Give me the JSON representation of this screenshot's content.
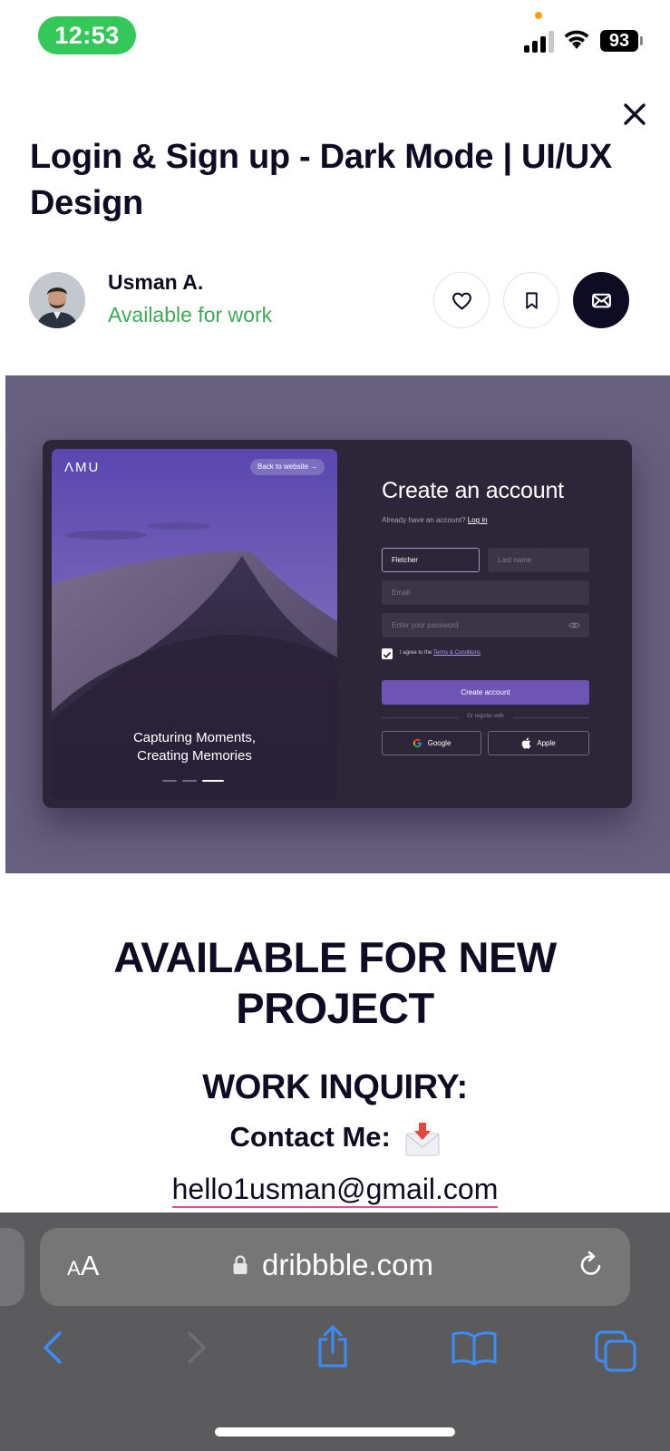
{
  "status_bar": {
    "time": "12:53",
    "battery": "93"
  },
  "shot": {
    "title": "Login & Sign up - Dark Mode | UI/UX Design",
    "author": {
      "name": "Usman A.",
      "status": "Available for work"
    },
    "actions": [
      "like",
      "save",
      "message"
    ],
    "preview": {
      "logo": "ΛMU",
      "back_link": "Back to website",
      "caption_line1": "Capturing Moments,",
      "caption_line2": "Creating Memories",
      "form_title": "Create an account",
      "have_account": "Already have an account?",
      "login_link": "Log in",
      "first_name_value": "Fletcher",
      "last_name_placeholder": "Last name",
      "email_placeholder": "Email",
      "password_placeholder": "Enter your password",
      "agree_prefix": "I agree to the",
      "terms_link": "Terms & Conditions",
      "create_button": "Create account",
      "divider_text": "Or register with",
      "google_button": "Google",
      "apple_button": "Apple",
      "accent_color": "#6e54b5"
    }
  },
  "description": {
    "heading_line1": "AVAILABLE FOR NEW",
    "heading_line2": "PROJECT",
    "inquiry": "WORK INQUIRY:",
    "contact": "Contact Me:",
    "email": "hello1usman@gmail.com"
  },
  "browser": {
    "text_size_label": "AA",
    "url": "dribbble.com"
  },
  "colors": {
    "available_green": "#3fa957",
    "time_pill": "#34c759",
    "ios_blue": "#3a8dff"
  }
}
